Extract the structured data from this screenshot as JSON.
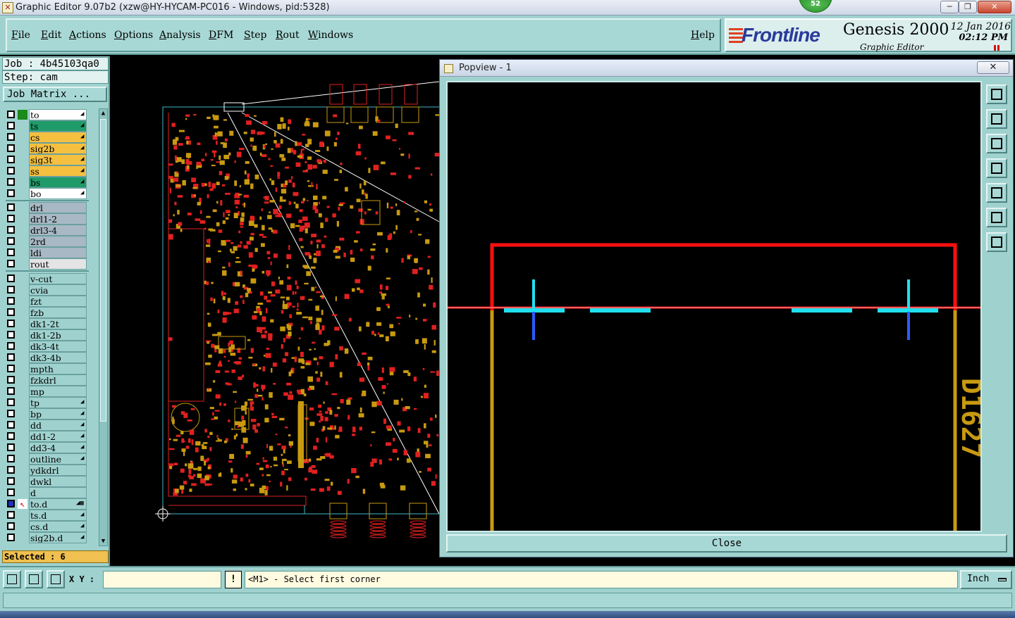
{
  "window": {
    "title": "Graphic Editor 9.07b2 (xzw@HY-HYCAM-PC016 - Windows, pid:5328)",
    "badge": "52",
    "min_glyph": "─",
    "max_glyph": "❐",
    "close_glyph": "✕"
  },
  "menu": {
    "items": [
      "File",
      "Edit",
      "Actions",
      "Options",
      "Analysis",
      "DFM",
      "Step",
      "Rout",
      "Windows"
    ],
    "help": "Help"
  },
  "brand": {
    "logo": "Frontline",
    "product": "Genesis 2000",
    "module": "Graphic Editor",
    "date": "12 Jan 2016",
    "time": "02:12 PM"
  },
  "panel": {
    "job": "Job : 4b45103qa0",
    "step": "Step: cam",
    "job_matrix": "Job Matrix ...",
    "selected": "Selected : 6"
  },
  "layers": [
    {
      "name": "to",
      "bg": "#ffffff",
      "swatch": "#1a8a1a",
      "mark": "◢"
    },
    {
      "name": "ts",
      "bg": "#1f9b6a",
      "swatch": "",
      "mark": "◢"
    },
    {
      "name": "cs",
      "bg": "#f5c040",
      "swatch": "",
      "mark": "◢"
    },
    {
      "name": "sig2b",
      "bg": "#f5c040",
      "swatch": "",
      "mark": "◢"
    },
    {
      "name": "sig3t",
      "bg": "#f5c040",
      "swatch": "",
      "mark": "◢"
    },
    {
      "name": "ss",
      "bg": "#f5c040",
      "swatch": "",
      "mark": "◢"
    },
    {
      "name": "bs",
      "bg": "#1f9b6a",
      "swatch": "",
      "mark": "◢"
    },
    {
      "name": "bo",
      "bg": "#ffffff",
      "swatch": "",
      "mark": "◢"
    },
    {
      "name": "drl",
      "bg": "#a8b8c4",
      "swatch": "",
      "mark": ""
    },
    {
      "name": "drl1-2",
      "bg": "#a8b8c4",
      "swatch": "",
      "mark": ""
    },
    {
      "name": "drl3-4",
      "bg": "#a8b8c4",
      "swatch": "",
      "mark": ""
    },
    {
      "name": "2rd",
      "bg": "#a8b8c4",
      "swatch": "",
      "mark": ""
    },
    {
      "name": "ldi",
      "bg": "#a8b8c4",
      "swatch": "",
      "mark": ""
    },
    {
      "name": "rout",
      "bg": "#e4e4e4",
      "swatch": "",
      "mark": ""
    },
    {
      "name": "v-cut",
      "bg": "#9fd2cf",
      "swatch": "",
      "mark": ""
    },
    {
      "name": "cvia",
      "bg": "#9fd2cf",
      "swatch": "",
      "mark": ""
    },
    {
      "name": "fzt",
      "bg": "#9fd2cf",
      "swatch": "",
      "mark": ""
    },
    {
      "name": "fzb",
      "bg": "#9fd2cf",
      "swatch": "",
      "mark": ""
    },
    {
      "name": "dk1-2t",
      "bg": "#9fd2cf",
      "swatch": "",
      "mark": ""
    },
    {
      "name": "dk1-2b",
      "bg": "#9fd2cf",
      "swatch": "",
      "mark": ""
    },
    {
      "name": "dk3-4t",
      "bg": "#9fd2cf",
      "swatch": "",
      "mark": ""
    },
    {
      "name": "dk3-4b",
      "bg": "#9fd2cf",
      "swatch": "",
      "mark": ""
    },
    {
      "name": "mpth",
      "bg": "#9fd2cf",
      "swatch": "",
      "mark": ""
    },
    {
      "name": "fzkdrl",
      "bg": "#9fd2cf",
      "swatch": "",
      "mark": ""
    },
    {
      "name": "mp",
      "bg": "#9fd2cf",
      "swatch": "",
      "mark": ""
    },
    {
      "name": "tp",
      "bg": "#9fd2cf",
      "swatch": "",
      "mark": "◢"
    },
    {
      "name": "bp",
      "bg": "#9fd2cf",
      "swatch": "",
      "mark": "◢"
    },
    {
      "name": "dd",
      "bg": "#9fd2cf",
      "swatch": "",
      "mark": "◢"
    },
    {
      "name": "dd1-2",
      "bg": "#9fd2cf",
      "swatch": "",
      "mark": "◢"
    },
    {
      "name": "dd3-4",
      "bg": "#9fd2cf",
      "swatch": "",
      "mark": "◢"
    },
    {
      "name": "outline",
      "bg": "#9fd2cf",
      "swatch": "",
      "mark": "◢"
    },
    {
      "name": "ydkdrl",
      "bg": "#9fd2cf",
      "swatch": "",
      "mark": ""
    },
    {
      "name": "dwkl",
      "bg": "#9fd2cf",
      "swatch": "",
      "mark": ""
    },
    {
      "name": "d",
      "bg": "#9fd2cf",
      "swatch": "",
      "mark": ""
    },
    {
      "name": "to.d",
      "bg": "#9fd2cf",
      "swatch": "#ffffff",
      "mark": "◢▦"
    },
    {
      "name": "ts.d",
      "bg": "#9fd2cf",
      "swatch": "",
      "mark": "◢"
    },
    {
      "name": "cs.d",
      "bg": "#9fd2cf",
      "swatch": "",
      "mark": "◢"
    },
    {
      "name": "sig2b.d",
      "bg": "#9fd2cf",
      "swatch": "",
      "mark": "◢"
    }
  ],
  "popview": {
    "title": "Popview - 1",
    "close_x": "✕",
    "close_button": "Close",
    "label_glyph": "D1627",
    "tools": [
      "zoom-window-icon",
      "zoom-in-icon",
      "zoom-out-icon",
      "pan-left-icon",
      "pan-right-icon",
      "fit-screen-icon",
      "fit-profile-icon"
    ]
  },
  "cmdbar": {
    "xy_label": "X Y :",
    "xy_value": "",
    "warn": "!",
    "prompt": "<M1> - Select first corner",
    "units": "Inch"
  },
  "colors": {
    "panel_bg": "#9fd2cf",
    "red": "#ff1010",
    "cyan": "#20e0f0",
    "gold": "#c89a10",
    "blue": "#2a5cff"
  }
}
